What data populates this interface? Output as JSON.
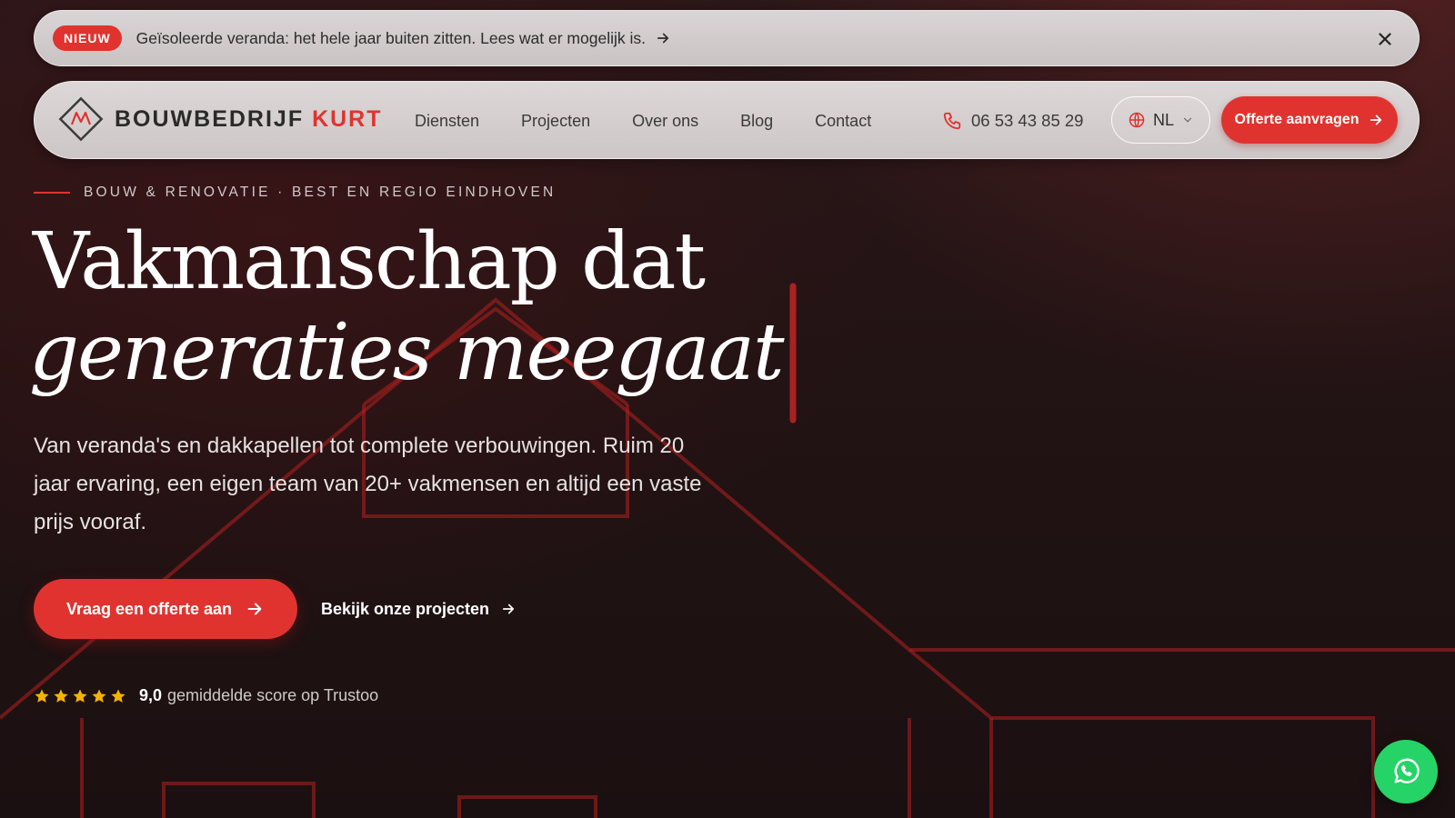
{
  "announcement": {
    "badge": "NIEUW",
    "text": "Geïsoleerde veranda: het hele jaar buiten zitten. Lees wat er mogelijk is.",
    "arrow_icon": "arrow-right-icon",
    "close_icon": "close-icon"
  },
  "brand": {
    "name_main": "BOUWBEDRIJF",
    "name_accent": "KURT",
    "accent_color": "#e0332f"
  },
  "nav": {
    "links": [
      "Diensten",
      "Projecten",
      "Over ons",
      "Blog",
      "Contact"
    ],
    "phone": "06 53 43 85 29",
    "language": "NL",
    "cta": "Offerte aanvragen"
  },
  "hero": {
    "eyebrow": "BOUW & RENOVATIE · BEST EN REGIO EINDHOVEN",
    "title_line1": "Vakmanschap dat",
    "title_line2": "generaties meegaat",
    "lead": "Van veranda's en dakkapellen tot complete verbouwingen. Ruim 20 jaar ervaring, een eigen team van 20+ vakmensen en altijd een vaste prijs vooraf.",
    "primary_cta": "Vraag een offerte aan",
    "secondary_cta": "Bekijk onze projecten"
  },
  "rating": {
    "stars": 5,
    "score": "9,0",
    "text": "gemiddelde score op Trustoo",
    "star_color": "#f5b301"
  },
  "whatsapp": {
    "icon": "whatsapp-icon",
    "color": "#25d366"
  }
}
